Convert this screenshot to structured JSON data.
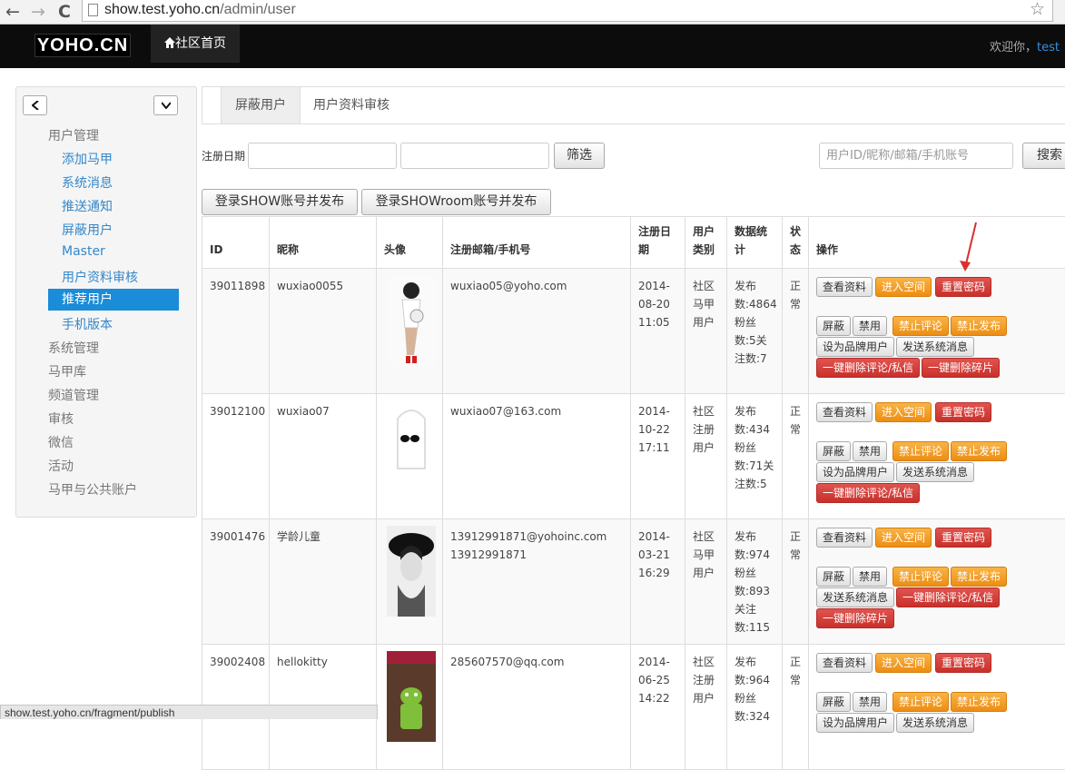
{
  "browser": {
    "url_domain": "show.test.yoho.cn",
    "url_path": "/admin/user",
    "back": "←",
    "forward": "→",
    "reload": "C",
    "star": "☆"
  },
  "topnav": {
    "logo": "YOHO.CN",
    "home_icon": "home-icon",
    "home_label": "社区首页",
    "welcome": "欢迎你，",
    "user": "test"
  },
  "sidebar": {
    "collapse": "◀",
    "expand": "▼",
    "sections": [
      {
        "label": "用户管理",
        "items": [
          "添加马甲",
          "系统消息",
          "推送通知",
          "屏蔽用户",
          "Master",
          "用户资料审核",
          "推荐用户",
          "手机版本"
        ]
      }
    ],
    "headers": [
      "系统管理",
      "马甲库",
      "频道管理",
      "审核",
      "微信",
      "活动",
      "马甲与公共账户"
    ],
    "active_item": "推荐用户"
  },
  "tabs": [
    "屏蔽用户",
    "用户资料审核"
  ],
  "filters": {
    "date_label": "注册日期",
    "date_from": "",
    "date_to": "",
    "filter_btn": "筛选",
    "search_placeholder": "用户ID/昵称/邮箱/手机账号",
    "search_btn": "搜索"
  },
  "actions": {
    "login_show": "登录SHOW账号并发布",
    "login_showroom": "登录SHOWroom账号并发布"
  },
  "table": {
    "headers": [
      "ID",
      "昵称",
      "头像",
      "注册邮箱/手机号",
      "注册日期",
      "用户类别",
      "数据统计",
      "状态",
      "操作"
    ],
    "buttons": {
      "view": "查看资料",
      "enter": "进入空间",
      "reset": "重置密码",
      "block": "屏蔽",
      "ban": "禁用",
      "no_comment": "禁止评论",
      "no_post": "禁止发布",
      "set_brand": "设为品牌用户",
      "send_msg": "发送系统消息",
      "del_comments": "一键删除评论/私信",
      "del_fragments": "一键删除碎片"
    },
    "rows": [
      {
        "id": "39011898",
        "nick": "wuxiao0055",
        "contact": "wuxiao05@yoho.com",
        "contact2": "",
        "date": "2014-08-20 11:05",
        "type": "社区马甲用户",
        "stats": "发布数:4864粉丝数:5关注数:7",
        "status": "正常"
      },
      {
        "id": "39012100",
        "nick": "wuxiao07",
        "contact": "wuxiao07@163.com",
        "contact2": "",
        "date": "2014-10-22 17:11",
        "type": "社区注册用户",
        "stats": "发布数:434粉丝数:71关注数:5",
        "status": "正常"
      },
      {
        "id": "39001476",
        "nick": "学龄儿童",
        "contact": "13912991871@yohoinc.com",
        "contact2": "13912991871",
        "date": "2014-03-21 16:29",
        "type": "社区马甲用户",
        "stats": "发布数:974粉丝数:893关注数:115",
        "status": "正常"
      },
      {
        "id": "39002408",
        "nick": "hellokitty",
        "contact": "285607570@qq.com",
        "contact2": "",
        "date": "2014-06-25 14:22",
        "type": "社区注册用户",
        "stats": "发布数:964粉丝数:324",
        "status": "正常"
      }
    ]
  },
  "statusbar": "show.test.yoho.cn/fragment/publish"
}
